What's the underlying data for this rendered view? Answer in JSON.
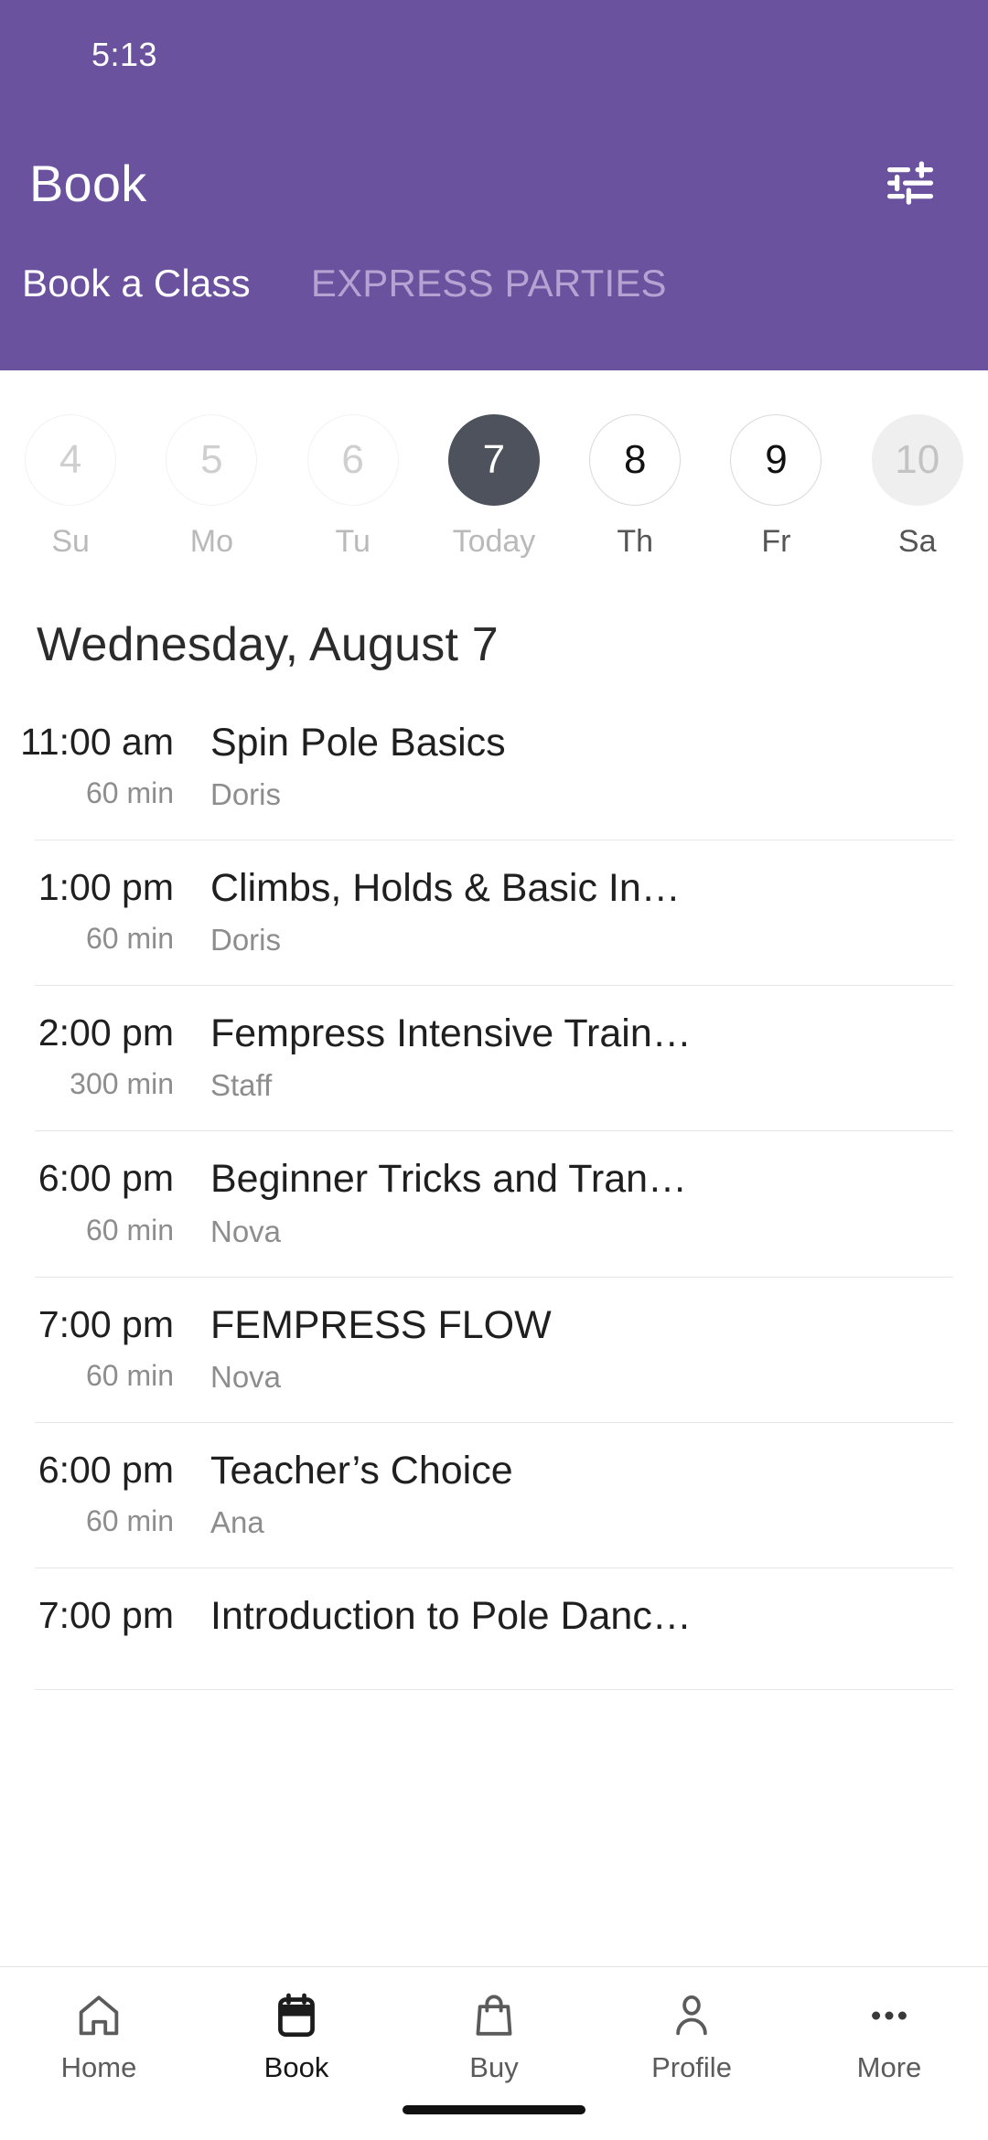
{
  "status_bar": {
    "time": "5:13"
  },
  "app_bar": {
    "title": "Book",
    "filter_icon": "filter-sliders-icon"
  },
  "theme": {
    "header_purple": "#6b529f",
    "inactive_tab": "#b6a3d2",
    "today_circle": "#4d525c",
    "muted_text": "#8d8d8d"
  },
  "tabs": [
    {
      "label": "Book a Class",
      "active": true
    },
    {
      "label": "EXPRESS PARTIES",
      "active": false
    }
  ],
  "date_strip": {
    "days": [
      {
        "number": "4",
        "weekday": "Su",
        "state": "past"
      },
      {
        "number": "5",
        "weekday": "Mo",
        "state": "past"
      },
      {
        "number": "6",
        "weekday": "Tu",
        "state": "past"
      },
      {
        "number": "7",
        "weekday": "Today",
        "state": "today"
      },
      {
        "number": "8",
        "weekday": "Th",
        "state": "future"
      },
      {
        "number": "9",
        "weekday": "Fr",
        "state": "future"
      },
      {
        "number": "10",
        "weekday": "Sa",
        "state": "muted"
      }
    ]
  },
  "date_heading": "Wednesday, August 7",
  "classes": [
    {
      "time": "11:00 am",
      "duration": "60 min",
      "name": "Spin Pole Basics",
      "instructor": "Doris"
    },
    {
      "time": "1:00 pm",
      "duration": "60 min",
      "name": "Climbs, Holds & Basic In…",
      "instructor": "Doris"
    },
    {
      "time": "2:00 pm",
      "duration": "300 min",
      "name": "Fempress Intensive Train…",
      "instructor": "Staff"
    },
    {
      "time": "6:00 pm",
      "duration": "60 min",
      "name": "Beginner Tricks and Tran…",
      "instructor": "Nova"
    },
    {
      "time": "7:00 pm",
      "duration": "60 min",
      "name": "FEMPRESS FLOW",
      "instructor": "Nova"
    },
    {
      "time": "6:00 pm",
      "duration": "60 min",
      "name": "Teacher’s Choice",
      "instructor": "Ana"
    },
    {
      "time": "7:00 pm",
      "duration": "",
      "name": "Introduction to Pole Danc…",
      "instructor": ""
    }
  ],
  "bottom_nav": [
    {
      "label": "Home",
      "icon": "home-icon",
      "active": false
    },
    {
      "label": "Book",
      "icon": "calendar-icon",
      "active": true
    },
    {
      "label": "Buy",
      "icon": "bag-icon",
      "active": false
    },
    {
      "label": "Profile",
      "icon": "person-icon",
      "active": false
    },
    {
      "label": "More",
      "icon": "ellipsis-icon",
      "active": false
    }
  ]
}
